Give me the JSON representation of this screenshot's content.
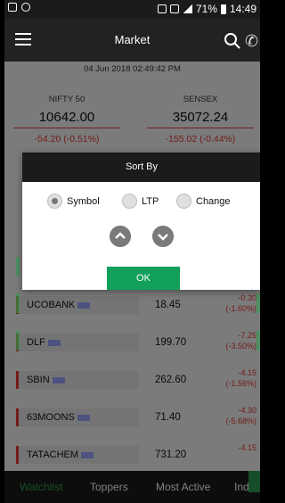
{
  "status_bar": {
    "battery": "71%",
    "time": "14:49"
  },
  "app_bar": {
    "title": "Market"
  },
  "timestamp": "04 Jun 2018 02:49:42 PM",
  "indices": [
    {
      "name": "NIFTY 50",
      "value": "10642.00",
      "change": "-54.20 (-0.51%)"
    },
    {
      "name": "SENSEX",
      "value": "35072.24",
      "change": "-155.02 (-0.44%)"
    }
  ],
  "watchlist": [
    {
      "symbol": "UCOBANK",
      "ltp": "18.45",
      "change": "-0.30",
      "pct": "(-1.60%)"
    },
    {
      "symbol": "DLF",
      "ltp": "199.70",
      "change": "-7.25",
      "pct": "(-3.50%)"
    },
    {
      "symbol": "SBIN",
      "ltp": "262.60",
      "change": "-4.15",
      "pct": "(-1.56%)"
    },
    {
      "symbol": "63MOONS",
      "ltp": "71.40",
      "change": "-4.30",
      "pct": "(-5.68%)"
    },
    {
      "symbol": "TATACHEM",
      "ltp": "731.20",
      "change": "-4.15",
      "pct": ""
    }
  ],
  "sort_dialog": {
    "title": "Sort By",
    "options": [
      "Symbol",
      "LTP",
      "Change"
    ],
    "selected": "Symbol",
    "ok_label": "OK"
  },
  "bottom_tabs": [
    "Watchlist",
    "Toppers",
    "Most Active",
    "Indic"
  ],
  "colors": {
    "accent": "#2e9d4f",
    "negative": "#e53935",
    "ok_button": "#12a05a"
  }
}
